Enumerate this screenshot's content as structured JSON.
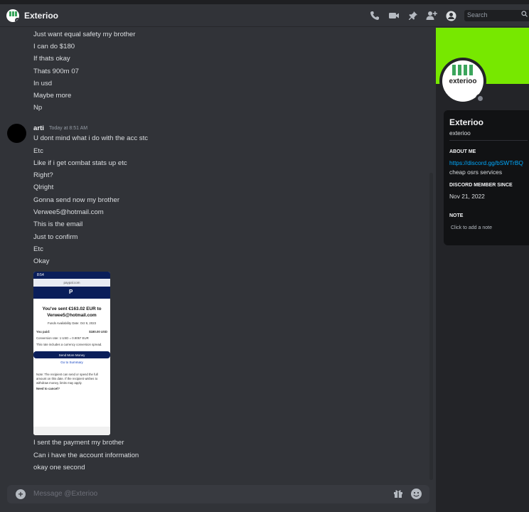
{
  "header": {
    "channel_name": "Exterioo",
    "search_placeholder": "Search",
    "icons": [
      "phone-call-icon",
      "video-icon",
      "pin-icon",
      "add-friend-icon",
      "user-profile-icon",
      "search-icon"
    ]
  },
  "messages_top": [
    "Just want equal safety my brother",
    "I can do $180",
    "If thats okay",
    "Thats 900m 07",
    "In usd",
    "Maybe more",
    "Np"
  ],
  "message_group": {
    "username": "arti",
    "timestamp": "Today at 8:51 AM",
    "lines": [
      "U dont mind what i do with the acc stc",
      "Etc",
      "Like if i get combat stats up etc",
      "Right?",
      "Qlright",
      "Gonna send now my brother",
      "Verwee5@hotmail.com",
      "This is the email",
      "Just to confirm",
      "Etc",
      "Okay"
    ],
    "after_attachment": [
      "I sent the payment my brother",
      "Can i have the account information",
      "okay one second"
    ]
  },
  "attachment": {
    "status_time": "8:54",
    "url": "paypal.com",
    "logo": "P",
    "headline_1": "You've sent €163.02 EUR to",
    "headline_2": "Verwee5@hotmail.com",
    "funds_date": "Funds Availability Date: Oct 9, 2023",
    "you_paid_label": "You paid:",
    "you_paid_value": "$180.00 USD",
    "conversion": "Conversion rate: 1 USD = 0.9057 EUR",
    "spread_note": "This rate includes a currency conversion spread.",
    "send_more": "Send More Money",
    "go_summary": "Go to Summary",
    "note": "Note: The recipient can send or spend the full amount on this date. If the recipient wishes to withdraw money, limits may apply.",
    "need_cancel": "Need to cancel?"
  },
  "composer": {
    "placeholder": "Message @Exterioo",
    "icons": [
      "plus-icon",
      "gift-icon",
      "emoji-icon"
    ]
  },
  "profile": {
    "avatar_text": "exterioo",
    "display_name": "Exterioo",
    "username": "exterioo",
    "about_heading": "ABOUT ME",
    "about_link": "https://discord.gg/bSWTrBQ",
    "about_text": "cheap osrs services",
    "member_since_heading": "DISCORD MEMBER SINCE",
    "member_since": "Nov 21, 2022",
    "note_heading": "NOTE",
    "note_placeholder": "Click to add a note",
    "banner_color": "#77e800"
  }
}
